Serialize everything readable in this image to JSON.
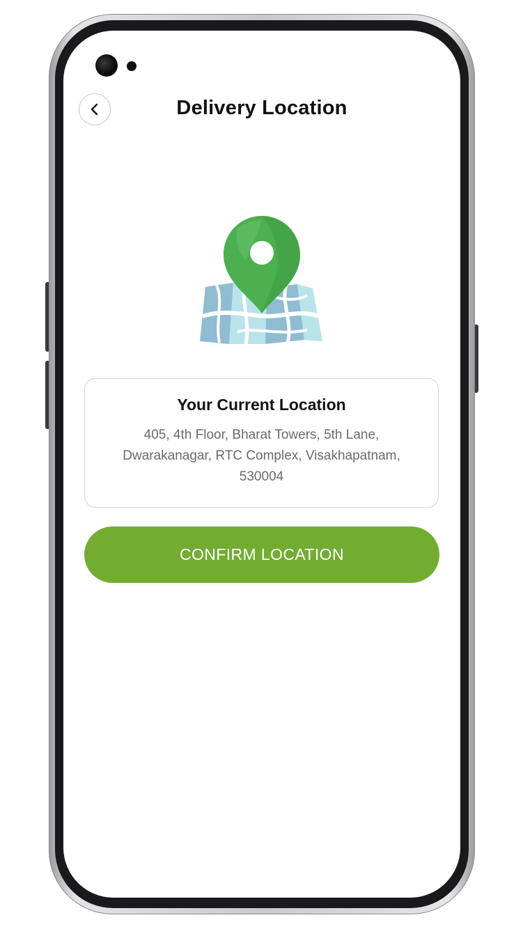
{
  "header": {
    "title": "Delivery Location",
    "back_icon": "chevron-left-icon"
  },
  "illustration": {
    "icon": "map-pin-icon",
    "pin_color": "#4caf50",
    "map_colors": [
      "#8fbcd1",
      "#b9e3ea"
    ]
  },
  "location_card": {
    "title": "Your Current Location",
    "address": "405, 4th Floor, Bharat Towers, 5th Lane, Dwarakanagar, RTC Complex, Visakhapatnam, 530004"
  },
  "actions": {
    "confirm_label": "CONFIRM LOCATION",
    "confirm_color": "#72ad32"
  }
}
